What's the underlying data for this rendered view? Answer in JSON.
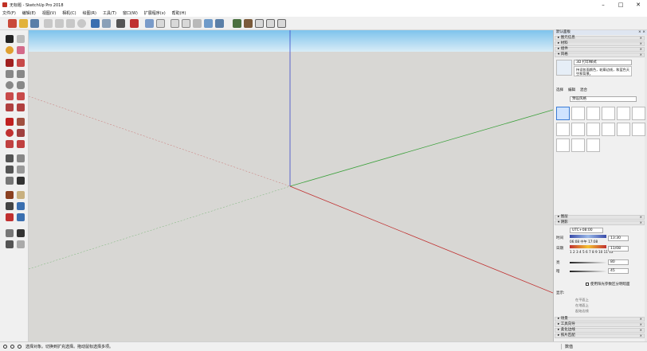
{
  "window": {
    "title": "无标题 - SketchUp Pro 2018",
    "min": "–",
    "max": "□",
    "close": "✕"
  },
  "menu": [
    "文件(F)",
    "编辑(E)",
    "视图(V)",
    "相机(C)",
    "绘图(R)",
    "工具(T)",
    "窗口(W)",
    "扩展程序(x)",
    "帮助(H)"
  ],
  "tray": {
    "title": "默认面板",
    "close": "× ×",
    "sections_top": [
      {
        "label": "▸ 图元信息",
        "x": "×"
      },
      {
        "label": "▸ 材料",
        "x": "×"
      },
      {
        "label": "▸ 组件",
        "x": "×"
      },
      {
        "label": "▾ 风格",
        "x": "×"
      }
    ],
    "style": {
      "name": "3D 打印样式",
      "desc": "持设各面颜色，轮廓边线，和蓝色天空和背景。",
      "tabs": [
        "选择",
        "编辑",
        "混合"
      ],
      "dropdown": "预设风格"
    },
    "sections_mid": [
      {
        "label": "▸ 图层",
        "x": "×"
      },
      {
        "label": "▾ 阴影",
        "x": "×"
      }
    ],
    "shadow": {
      "timezone": "UTC+08:00",
      "time_label": "时间",
      "date_label": "日期",
      "time_value": "13:30",
      "date_value": "11/08",
      "time_ticks": "06:08  中午  17:08",
      "date_ticks": "1 2 3 4 5 6 7 8 9 10 11 12",
      "light_label": "亮",
      "dark_label": "暗",
      "light_value": "80",
      "dark_value": "45",
      "use_sun": "使用阳光参数区分明暗面",
      "display_label": "显示:",
      "on_faces": "在平面上",
      "on_ground": "在地面上",
      "from_edges": "起始边线"
    },
    "sections_bottom": [
      {
        "label": "▸ 场景",
        "x": "×"
      },
      {
        "label": "▸ 工具向导",
        "x": "×"
      },
      {
        "label": "▸ 柔化边线",
        "x": "×"
      },
      {
        "label": "▸ 照片匹配",
        "x": "×"
      }
    ]
  },
  "status": {
    "hint": "选择对象。切换到扩充选择。拖动鼠标选择多项。",
    "measure": "数值"
  }
}
